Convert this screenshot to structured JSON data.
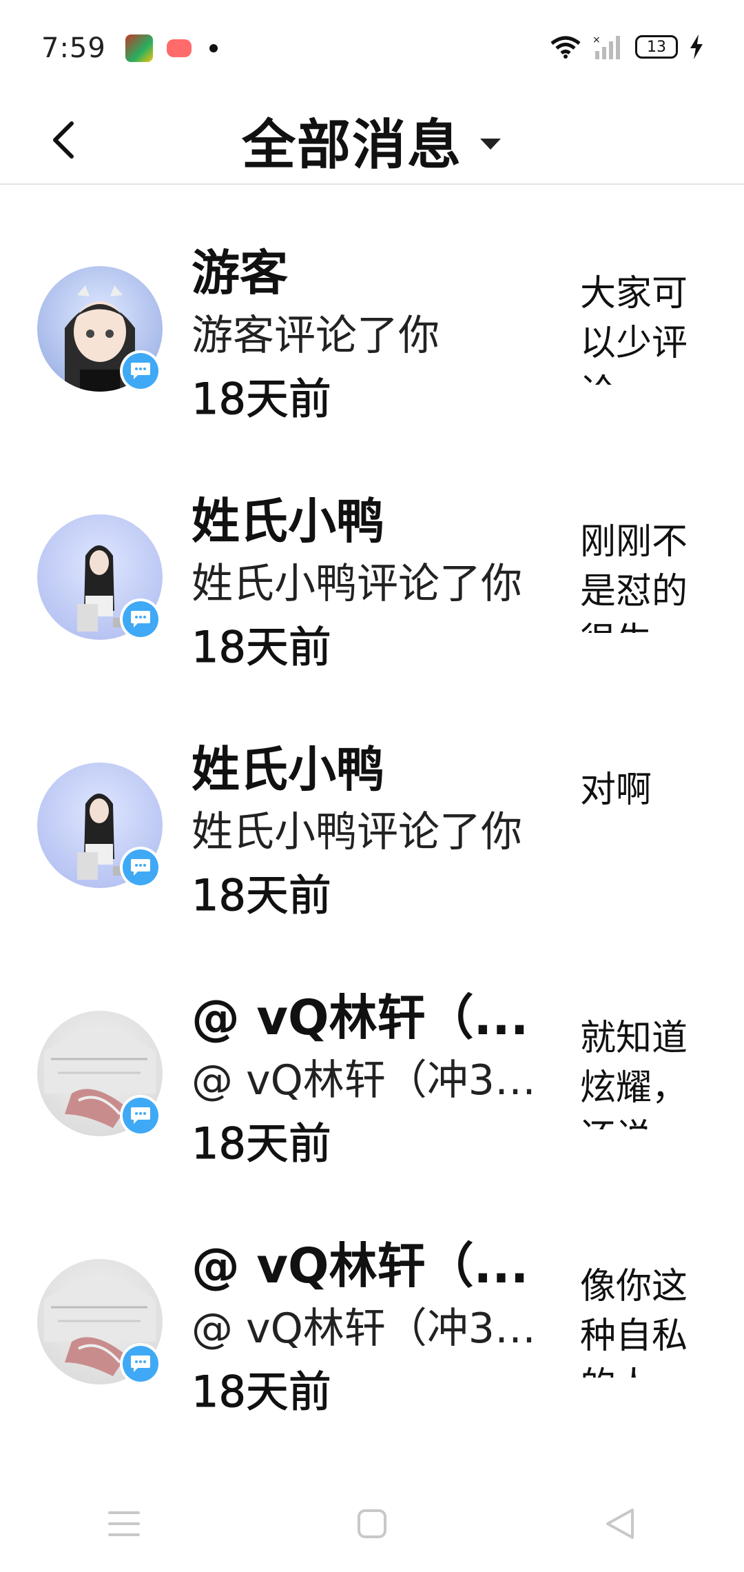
{
  "status_bar": {
    "time": "7:59",
    "battery": "13"
  },
  "header": {
    "title": "全部消息"
  },
  "messages": [
    {
      "name": "游客",
      "desc": "游客评论了你",
      "time": "18天前",
      "preview": "大家可以少评论一"
    },
    {
      "name": "姓氏小鸭",
      "desc": "姓氏小鸭评论了你",
      "time": "18天前",
      "preview": "刚刚不是怼的很生"
    },
    {
      "name": "姓氏小鸭",
      "desc": "姓氏小鸭评论了你",
      "time": "18天前",
      "preview": "对啊"
    },
    {
      "name": "@ vQ林轩（...",
      "desc": "@ vQ林轩（冲35...",
      "time": "18天前",
      "preview": "就知道炫耀，还说"
    },
    {
      "name": "@ vQ林轩（...",
      "desc": "@ vQ林轩（冲35...",
      "time": "18天前",
      "preview": "像你这种自私的人"
    }
  ],
  "colors": {
    "badge_blue": "#3fa9f5",
    "divider": "#e3e3e3"
  },
  "icons": [
    "back-arrow-icon",
    "dropdown-triangle-icon",
    "wifi-icon",
    "signal-icon",
    "battery-icon",
    "charging-icon",
    "chat-bubble-icon",
    "menu-icon",
    "home-icon",
    "back-triangle-icon"
  ]
}
